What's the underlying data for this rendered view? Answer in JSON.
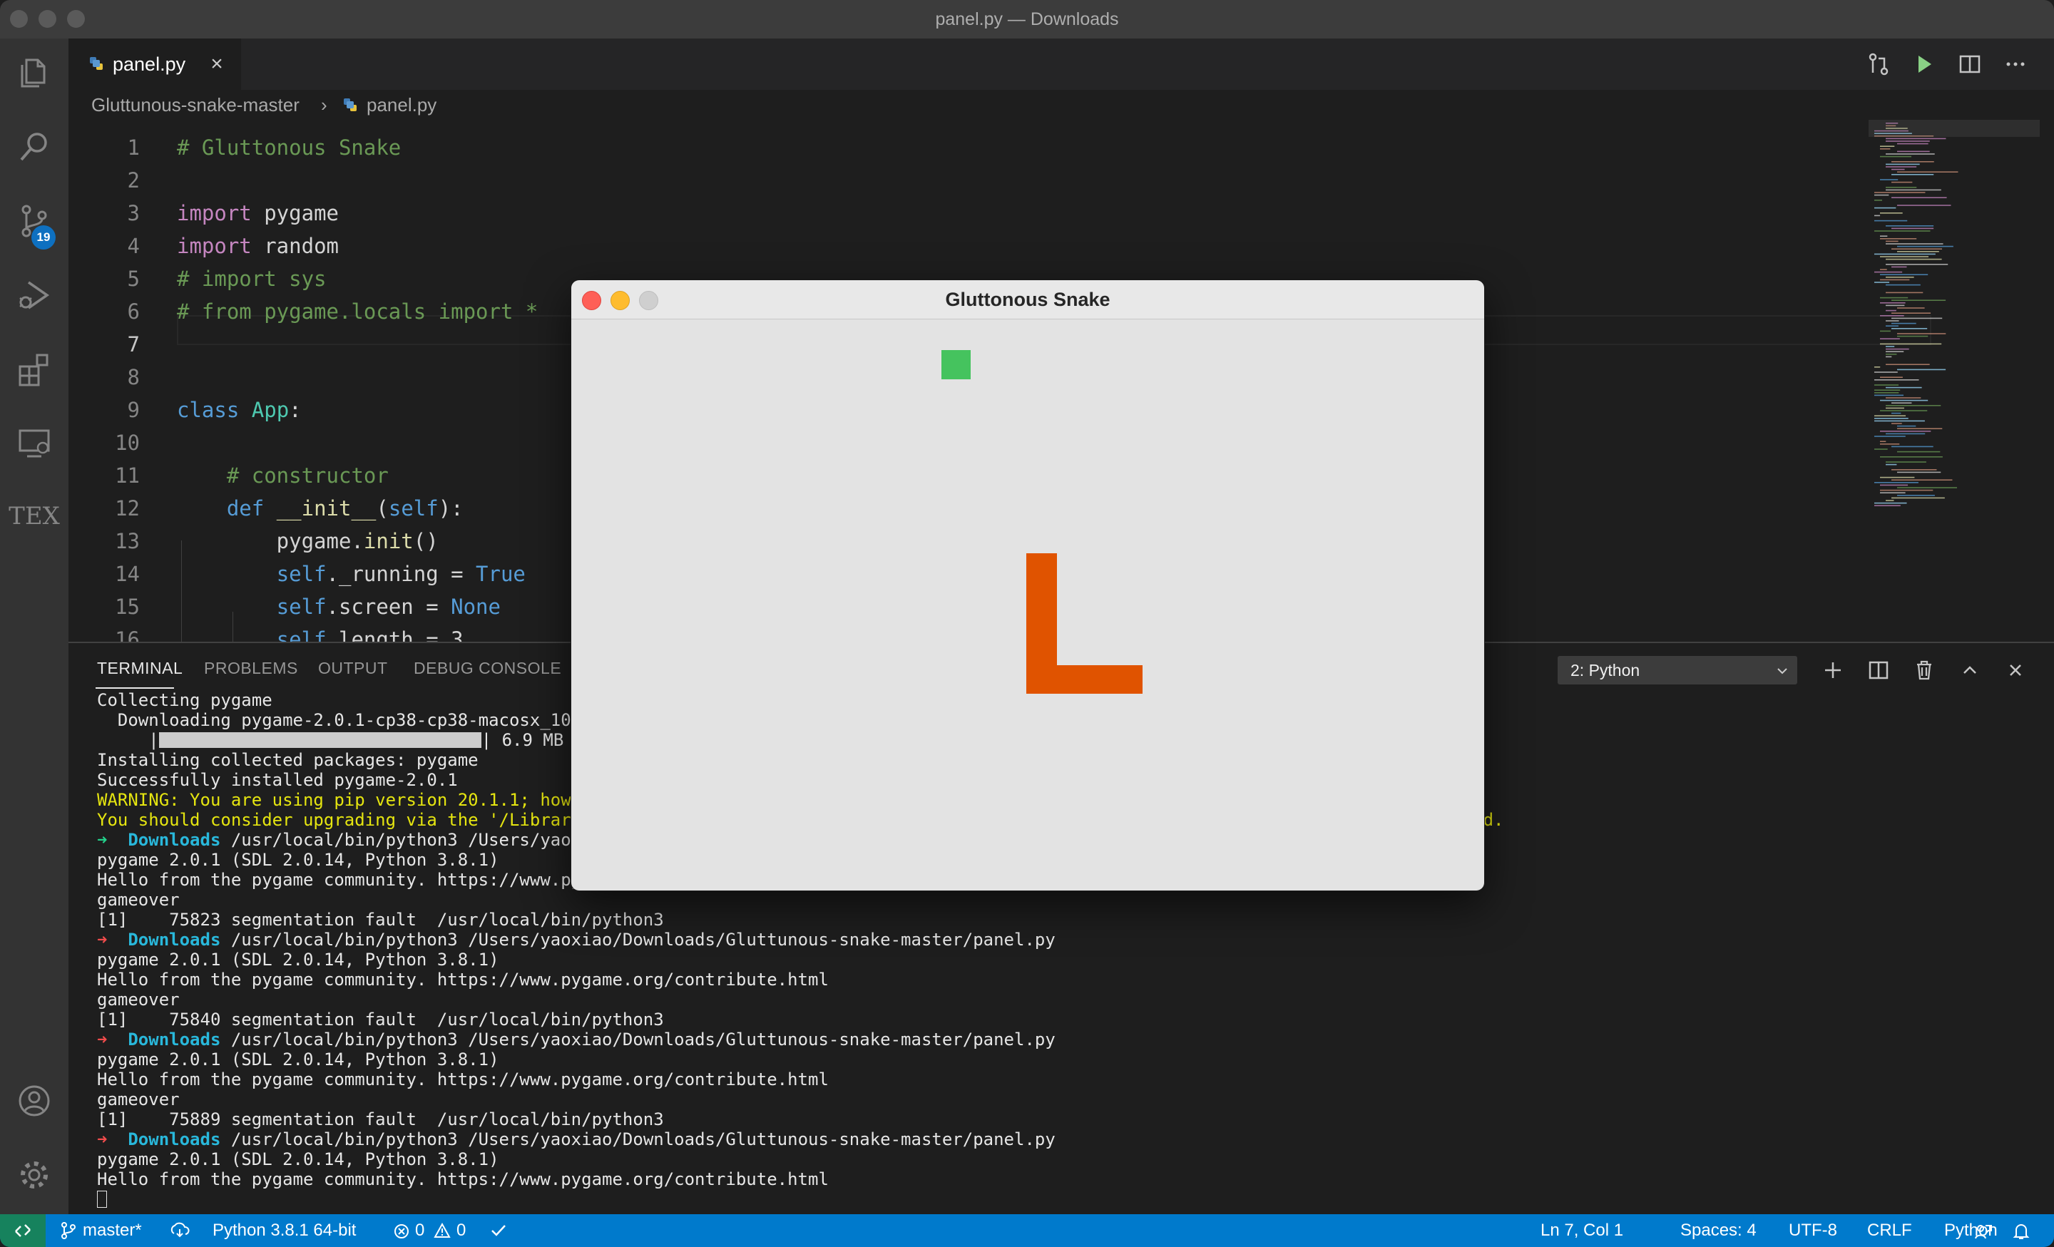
{
  "window": {
    "title": "panel.py — Downloads"
  },
  "activity_bar": {
    "scm_badge": "19",
    "tex_label": "TEX"
  },
  "tab": {
    "label": "panel.py"
  },
  "breadcrumb": {
    "folder": "Gluttunous-snake-master",
    "file": "panel.py"
  },
  "editor": {
    "lines": [
      {
        "n": "1",
        "segs": [
          [
            "cm",
            "# Gluttonous Snake"
          ]
        ]
      },
      {
        "n": "2",
        "segs": []
      },
      {
        "n": "3",
        "segs": [
          [
            "kw",
            "import"
          ],
          [
            "",
            " pygame"
          ]
        ]
      },
      {
        "n": "4",
        "segs": [
          [
            "kw",
            "import"
          ],
          [
            "",
            " random"
          ]
        ]
      },
      {
        "n": "5",
        "segs": [
          [
            "cm",
            "# import sys"
          ]
        ]
      },
      {
        "n": "6",
        "segs": [
          [
            "cm",
            "# from pygame.locals import *"
          ]
        ]
      },
      {
        "n": "7",
        "segs": []
      },
      {
        "n": "8",
        "segs": []
      },
      {
        "n": "9",
        "segs": [
          [
            "kb",
            "class"
          ],
          [
            "",
            " "
          ],
          [
            "cls",
            "App"
          ],
          [
            "",
            ":"
          ]
        ]
      },
      {
        "n": "10",
        "segs": []
      },
      {
        "n": "11",
        "segs": [
          [
            "",
            "    "
          ],
          [
            "cm",
            "# constructor"
          ]
        ]
      },
      {
        "n": "12",
        "segs": [
          [
            "",
            "    "
          ],
          [
            "kb",
            "def"
          ],
          [
            "",
            " "
          ],
          [
            "fn",
            "__init__"
          ],
          [
            "",
            "("
          ],
          [
            "sf",
            "self"
          ],
          [
            "",
            "):"
          ]
        ]
      },
      {
        "n": "13",
        "segs": [
          [
            "",
            "        pygame."
          ],
          [
            "fn",
            "init"
          ],
          [
            "",
            "()"
          ]
        ]
      },
      {
        "n": "14",
        "segs": [
          [
            "",
            "        "
          ],
          [
            "sf",
            "self"
          ],
          [
            "",
            "._running = "
          ],
          [
            "kb",
            "True"
          ]
        ]
      },
      {
        "n": "15",
        "segs": [
          [
            "",
            "        "
          ],
          [
            "sf",
            "self"
          ],
          [
            "",
            ".screen = "
          ],
          [
            "kb",
            "None"
          ]
        ]
      },
      {
        "n": "16",
        "segs": [
          [
            "",
            "        "
          ],
          [
            "sf",
            "self"
          ],
          [
            "",
            ".length = 3"
          ]
        ]
      }
    ],
    "current_line": "7"
  },
  "panel": {
    "tabs": [
      "TERMINAL",
      "PROBLEMS",
      "OUTPUT",
      "DEBUG CONSOLE"
    ],
    "terminal_select": "2: Python"
  },
  "terminal": [
    {
      "segs": [
        [
          "",
          "Collecting pygame"
        ]
      ]
    },
    {
      "segs": [
        [
          "",
          "  Downloading pygame-2.0.1-cp38-cp38-macosx_10_9"
        ]
      ]
    },
    {
      "segs": [
        [
          "",
          "     |"
        ],
        [
          "bar",
          ""
        ],
        [
          "",
          "| 6.9 MB 4"
        ]
      ]
    },
    {
      "segs": [
        [
          "",
          "Installing collected packages: pygame"
        ]
      ]
    },
    {
      "segs": [
        [
          "",
          "Successfully installed pygame-2.0.1"
        ]
      ]
    },
    {
      "segs": [
        [
          "yl",
          "WARNING: You are using pip version 20.1.1; howev"
        ]
      ]
    },
    {
      "segs": [
        [
          "yl",
          "You should consider upgrading via the '/Library/"
        ],
        [
          "gap",
          ""
        ],
        [
          "yl",
          "d."
        ]
      ]
    },
    {
      "segs": [
        [
          "arrow-g",
          "➜  "
        ],
        [
          "dl",
          "Downloads"
        ],
        [
          "",
          " /usr/local/bin/python3 /Users/yaoxi"
        ]
      ]
    },
    {
      "segs": [
        [
          "",
          "pygame 2.0.1 (SDL 2.0.14, Python 3.8.1)"
        ]
      ]
    },
    {
      "segs": [
        [
          "",
          "Hello from the pygame community. https://www.pyg"
        ]
      ]
    },
    {
      "segs": [
        [
          "",
          "gameover"
        ]
      ]
    },
    {
      "segs": [
        [
          "",
          "[1]    75823 segmentation fault  /usr/local/bin/python3"
        ]
      ]
    },
    {
      "segs": [
        [
          "arrow-r",
          "➜  "
        ],
        [
          "dl",
          "Downloads"
        ],
        [
          "",
          " /usr/local/bin/python3 /Users/yaoxiao/Downloads/Gluttunous-snake-master/panel.py"
        ]
      ]
    },
    {
      "segs": [
        [
          "",
          "pygame 2.0.1 (SDL 2.0.14, Python 3.8.1)"
        ]
      ]
    },
    {
      "segs": [
        [
          "",
          "Hello from the pygame community. https://www.pygame.org/contribute.html"
        ]
      ]
    },
    {
      "segs": [
        [
          "",
          "gameover"
        ]
      ]
    },
    {
      "segs": [
        [
          "",
          "[1]    75840 segmentation fault  /usr/local/bin/python3"
        ]
      ]
    },
    {
      "segs": [
        [
          "arrow-r",
          "➜  "
        ],
        [
          "dl",
          "Downloads"
        ],
        [
          "",
          " /usr/local/bin/python3 /Users/yaoxiao/Downloads/Gluttunous-snake-master/panel.py"
        ]
      ]
    },
    {
      "segs": [
        [
          "",
          "pygame 2.0.1 (SDL 2.0.14, Python 3.8.1)"
        ]
      ]
    },
    {
      "segs": [
        [
          "",
          "Hello from the pygame community. https://www.pygame.org/contribute.html"
        ]
      ]
    },
    {
      "segs": [
        [
          "",
          "gameover"
        ]
      ]
    },
    {
      "segs": [
        [
          "",
          "[1]    75889 segmentation fault  /usr/local/bin/python3"
        ]
      ]
    },
    {
      "segs": [
        [
          "arrow-r",
          "➜  "
        ],
        [
          "dl",
          "Downloads"
        ],
        [
          "",
          " /usr/local/bin/python3 /Users/yaoxiao/Downloads/Gluttunous-snake-master/panel.py"
        ]
      ]
    },
    {
      "segs": [
        [
          "",
          "pygame 2.0.1 (SDL 2.0.14, Python 3.8.1)"
        ]
      ]
    },
    {
      "segs": [
        [
          "",
          "Hello from the pygame community. https://www.pygame.org/contribute.html"
        ]
      ]
    },
    {
      "segs": [
        [
          "cursor",
          ""
        ]
      ]
    }
  ],
  "statusbar": {
    "branch": "master*",
    "python": "Python 3.8.1 64-bit",
    "errors": "0",
    "warnings": "0",
    "position": "Ln 7, Col 1",
    "spaces": "Spaces: 4",
    "encoding": "UTF-8",
    "eol": "CRLF",
    "language": "Python"
  },
  "game": {
    "title": "Gluttonous Snake",
    "food_color": "#45c35e",
    "snake_color": "#e05300",
    "background": "#e3e3e3"
  },
  "colors": {
    "accent": "#007acc",
    "remote": "#16825d",
    "badge": "#0e70c0"
  }
}
